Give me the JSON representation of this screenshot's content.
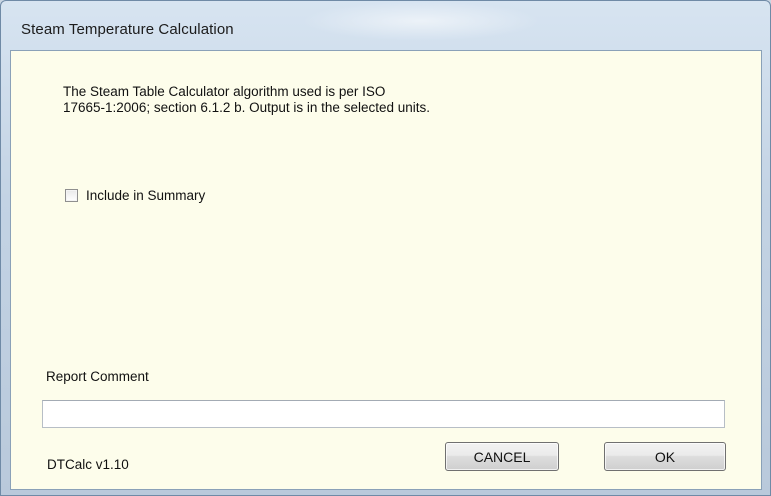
{
  "window": {
    "title": "Steam Temperature Calculation"
  },
  "content": {
    "description_line1": "The Steam Table Calculator algorithm used is per ISO",
    "description_line2": "17665-1:2006; section 6.1.2 b.   Output is in the selected units.",
    "include_summary_label": "Include in Summary",
    "include_summary_checked": false,
    "report_comment_label": "Report Comment",
    "report_comment_value": "",
    "version_label": "DTCalc v1.10"
  },
  "buttons": {
    "cancel_label": "CANCEL",
    "ok_label": "OK"
  },
  "colors": {
    "client_background": "#fdfdeb",
    "frame": "#c9d6e3"
  }
}
